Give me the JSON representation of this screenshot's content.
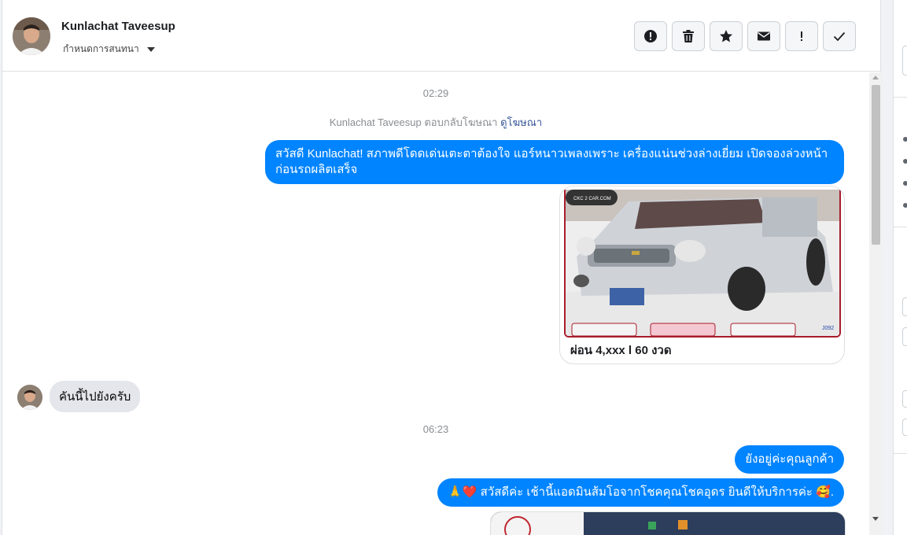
{
  "contact": {
    "name": "Kunlachat Taveesup",
    "assign_label": "กำหนดการสนทนา"
  },
  "toolbar": {
    "buttons": [
      {
        "icon": "exclamation-circle-icon",
        "label": "Mark as spam"
      },
      {
        "icon": "trash-icon",
        "label": "Delete"
      },
      {
        "icon": "star-icon",
        "label": "Star"
      },
      {
        "icon": "envelope-icon",
        "label": "Mark as unread"
      },
      {
        "icon": "exclamation-icon",
        "label": "Follow up"
      },
      {
        "icon": "check-icon",
        "label": "Mark as done"
      }
    ]
  },
  "messages": {
    "time1": "02:29",
    "system_text": "Kunlachat Taveesup ตอบกลับโฆษณา",
    "system_link": "ดูโฆษณา",
    "greeting": "สวัสดี Kunlachat! สภาพดีโดดเด่นเตะตาต้องใจ แอร์หนาวเพลงเพราะ เครื่องแน่นช่วงล่างเยี่ยม เปิดจองล่วงหน้าก่อนรถผลิตเสร็จ",
    "card_caption": "ผ่อน 4,xxx l 60 งวด",
    "card_brand": "CKC 2 CAR.COM",
    "card_code": "J092",
    "incoming_1": "คันนี้ไปยังครับ",
    "time2": "06:23",
    "reply_1": "ยังอยู่ค่ะคุณลูกค้า",
    "reply_2": "🙏❤️ สวัสดีค่ะ เช้านี้แอดมินส้มโอจากโชคคุณโชคอุดร ยินดีให้บริการค่ะ 🥰."
  },
  "colors": {
    "outgoing_bubble": "#0084ff",
    "incoming_bubble": "#e4e6eb",
    "link": "#385898"
  }
}
